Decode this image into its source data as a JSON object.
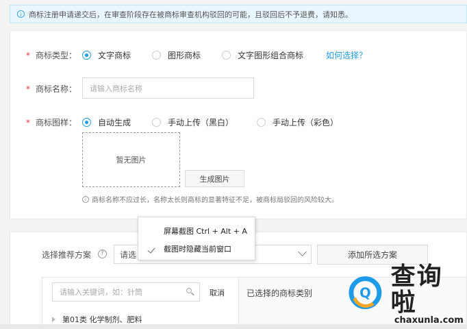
{
  "notice": {
    "text": "商标注册申请递交后，在审查阶段存在被商标审查机构驳回的可能，且驳回后不予退费，请知悉。",
    "icon": "info-icon"
  },
  "form": {
    "type": {
      "required_mark": "*",
      "label": "商标类型：",
      "options": [
        "文字商标",
        "图形商标",
        "文字图形组合商标"
      ],
      "selected": "文字商标",
      "help_link": "如何选择？"
    },
    "name": {
      "required_mark": "*",
      "label": "商标名称：",
      "placeholder": "请输入商标名称"
    },
    "design": {
      "required_mark": "*",
      "label": "商标图样：",
      "options": [
        "自动生成",
        "手动上传（黑白）",
        "手动上传（彩色）"
      ],
      "selected": "自动生成",
      "preview_text": "暂无图片",
      "generate_button": "生成图片",
      "hint": "商标名称不应过长，名称太长则商标的显著特征不足，被商标局驳回的风险较大。"
    }
  },
  "recommend": {
    "label": "选择推荐方案",
    "select_value": "请选",
    "add_button": "添加所选方案",
    "search_placeholder": "请输入关键词，如：针筒",
    "cancel": "取消",
    "selected_header": "已选择的商标类别",
    "tree_first": "第01类 化学制剂、肥料"
  },
  "context_menu": {
    "items": [
      "屏幕截图 Ctrl + Alt + A",
      "截图时隐藏当前窗口"
    ],
    "checked": "截图时隐藏当前窗口"
  },
  "watermark": {
    "main": "查询啦",
    "sub": "chaxunla.com"
  },
  "colors": {
    "accent": "#1e9be8",
    "required": "#ee3333",
    "notice_bg": "#eaf6fd",
    "watermark_ring": "#1e9be8",
    "watermark_arc": "#f5a623"
  }
}
